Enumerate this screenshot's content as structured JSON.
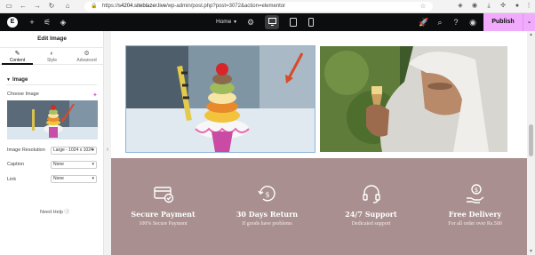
{
  "browser": {
    "url_prefix": "https://",
    "url_domain": "s4204.siteblazer.live",
    "url_path": "/wp-admin/post.php?post=3072&action=elementor"
  },
  "topbar": {
    "page_selector": "Home",
    "publish_label": "Publish"
  },
  "panel": {
    "title": "Edit Image",
    "tabs": [
      {
        "label": "Content",
        "icon": "pencil-icon",
        "active": true
      },
      {
        "label": "Style",
        "icon": "half-circle-icon",
        "active": false
      },
      {
        "label": "Advanced",
        "icon": "gear-icon",
        "active": false
      }
    ],
    "section_title": "Image",
    "choose_image_label": "Choose Image",
    "image_resolution_label": "Image Resolution",
    "image_resolution_value": "Large - 1024 x 1024",
    "caption_label": "Caption",
    "caption_value": "None",
    "link_label": "Link",
    "link_value": "None",
    "need_help": "Need Help"
  },
  "features": [
    {
      "icon": "card-check-icon",
      "title": "Secure Payment",
      "subtitle": "100% Secure Payment"
    },
    {
      "icon": "return-dollar-icon",
      "title": "30 Days Return",
      "subtitle": "If goods have problems"
    },
    {
      "icon": "headset-icon",
      "title": "24/7 Support",
      "subtitle": "Dedicated support"
    },
    {
      "icon": "hand-dollar-icon",
      "title": "Free Delivery",
      "subtitle": "For all order over Rs.500"
    }
  ],
  "colors": {
    "accent": "#f0abfc",
    "features_bg": "#a98f8f",
    "topbar_bg": "#0c0d0e"
  }
}
